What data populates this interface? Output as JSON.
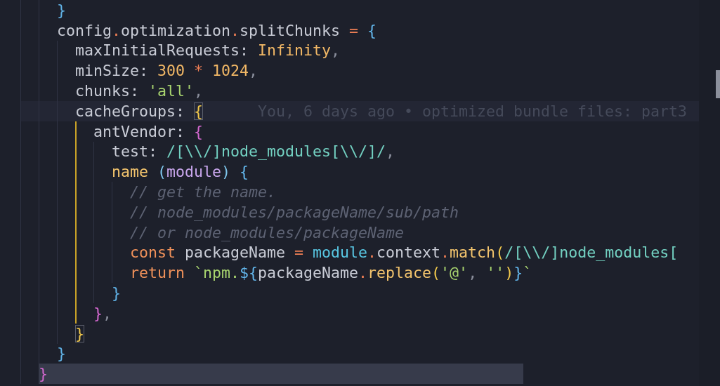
{
  "editor": {
    "lines": [
      {
        "cursor_line": false,
        "selected": false,
        "bracket_guide": false,
        "tokens": [
          {
            "text": "    }",
            "kind": "bracket1"
          }
        ]
      },
      {
        "cursor_line": false,
        "selected": false,
        "bracket_guide": false,
        "tokens": [
          {
            "text": "    config",
            "kind": "plain"
          },
          {
            "text": ".",
            "kind": "punct"
          },
          {
            "text": "optimization",
            "kind": "plain"
          },
          {
            "text": ".",
            "kind": "punct"
          },
          {
            "text": "splitChunks",
            "kind": "plain"
          },
          {
            "text": " = ",
            "kind": "op"
          },
          {
            "text": "{",
            "kind": "bracket1"
          }
        ]
      },
      {
        "cursor_line": false,
        "selected": false,
        "bracket_guide": false,
        "tokens": [
          {
            "text": "      maxInitialRequests: ",
            "kind": "plain"
          },
          {
            "text": "Infinity",
            "kind": "num"
          },
          {
            "text": ",",
            "kind": "comma"
          }
        ]
      },
      {
        "cursor_line": false,
        "selected": false,
        "bracket_guide": false,
        "tokens": [
          {
            "text": "      minSize: ",
            "kind": "plain"
          },
          {
            "text": "300",
            "kind": "num"
          },
          {
            "text": " * ",
            "kind": "op"
          },
          {
            "text": "1024",
            "kind": "num"
          },
          {
            "text": ",",
            "kind": "comma"
          }
        ]
      },
      {
        "cursor_line": false,
        "selected": false,
        "bracket_guide": false,
        "tokens": [
          {
            "text": "      chunks: ",
            "kind": "plain"
          },
          {
            "text": "'all'",
            "kind": "str"
          },
          {
            "text": ",",
            "kind": "comma"
          }
        ]
      },
      {
        "cursor_line": true,
        "selected": false,
        "bracket_guide": false,
        "tokens": [
          {
            "text": "      cacheGroups: ",
            "kind": "plain"
          },
          {
            "text": "{",
            "kind": "bracket2",
            "matched": true
          }
        ],
        "blame": "You, 6 days ago • optimized bundle files: part3"
      },
      {
        "cursor_line": false,
        "selected": false,
        "bracket_guide": true,
        "tokens": [
          {
            "text": "        antVendor: ",
            "kind": "plain"
          },
          {
            "text": "{",
            "kind": "bracket3"
          }
        ]
      },
      {
        "cursor_line": false,
        "selected": false,
        "bracket_guide": true,
        "tokens": [
          {
            "text": "          test: ",
            "kind": "plain"
          },
          {
            "text": "/[\\\\/]node_modules[\\\\/]/",
            "kind": "regex"
          },
          {
            "text": ",",
            "kind": "comma"
          }
        ]
      },
      {
        "cursor_line": false,
        "selected": false,
        "bracket_guide": true,
        "tokens": [
          {
            "text": "          name",
            "kind": "func"
          },
          {
            "text": " (",
            "kind": "paren"
          },
          {
            "text": "module",
            "kind": "param"
          },
          {
            "text": ") ",
            "kind": "paren"
          },
          {
            "text": "{",
            "kind": "bracket1"
          }
        ]
      },
      {
        "cursor_line": false,
        "selected": false,
        "bracket_guide": true,
        "tokens": [
          {
            "text": "            // get the name.",
            "kind": "comment"
          }
        ]
      },
      {
        "cursor_line": false,
        "selected": false,
        "bracket_guide": true,
        "tokens": [
          {
            "text": "            // node_modules/packageName/sub/path",
            "kind": "comment"
          }
        ]
      },
      {
        "cursor_line": false,
        "selected": false,
        "bracket_guide": true,
        "tokens": [
          {
            "text": "            // or node_modules/packageName",
            "kind": "comment"
          }
        ]
      },
      {
        "cursor_line": false,
        "selected": false,
        "bracket_guide": true,
        "tokens": [
          {
            "text": "            const",
            "kind": "keyword"
          },
          {
            "text": " packageName",
            "kind": "plain"
          },
          {
            "text": " = ",
            "kind": "op"
          },
          {
            "text": "module",
            "kind": "builtin"
          },
          {
            "text": ".",
            "kind": "punct"
          },
          {
            "text": "context",
            "kind": "plain"
          },
          {
            "text": ".",
            "kind": "punct"
          },
          {
            "text": "match",
            "kind": "func"
          },
          {
            "text": "(",
            "kind": "bracket2"
          },
          {
            "text": "/[\\\\/]node_modules[",
            "kind": "regex"
          }
        ]
      },
      {
        "cursor_line": false,
        "selected": false,
        "bracket_guide": true,
        "tokens": [
          {
            "text": "            return",
            "kind": "keyword"
          },
          {
            "text": " `npm.",
            "kind": "str"
          },
          {
            "text": "${",
            "kind": "bracket1"
          },
          {
            "text": "packageName",
            "kind": "plain"
          },
          {
            "text": ".",
            "kind": "punct"
          },
          {
            "text": "replace",
            "kind": "func"
          },
          {
            "text": "(",
            "kind": "bracket2"
          },
          {
            "text": "'@'",
            "kind": "str"
          },
          {
            "text": ", ",
            "kind": "comma"
          },
          {
            "text": "''",
            "kind": "str"
          },
          {
            "text": ")",
            "kind": "bracket2"
          },
          {
            "text": "}",
            "kind": "bracket1"
          },
          {
            "text": "`",
            "kind": "str"
          }
        ]
      },
      {
        "cursor_line": false,
        "selected": false,
        "bracket_guide": true,
        "tokens": [
          {
            "text": "          }",
            "kind": "bracket1"
          }
        ]
      },
      {
        "cursor_line": false,
        "selected": false,
        "bracket_guide": true,
        "tokens": [
          {
            "text": "        }",
            "kind": "bracket3"
          },
          {
            "text": ",",
            "kind": "comma"
          }
        ]
      },
      {
        "cursor_line": false,
        "selected": false,
        "bracket_guide": false,
        "tokens": [
          {
            "text": "      }",
            "kind": "bracket2",
            "matched": true
          }
        ]
      },
      {
        "cursor_line": false,
        "selected": false,
        "bracket_guide": false,
        "tokens": [
          {
            "text": "    }",
            "kind": "bracket1"
          }
        ]
      },
      {
        "cursor_line": false,
        "selected": true,
        "bracket_guide": false,
        "tokens": [
          {
            "text": "  }",
            "kind": "bracket3"
          }
        ]
      }
    ]
  }
}
